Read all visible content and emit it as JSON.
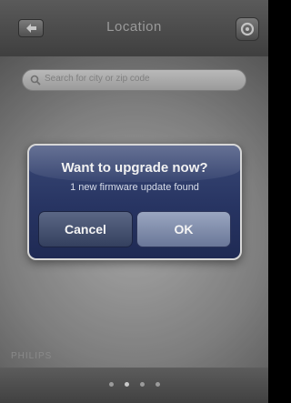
{
  "header": {
    "title": "Location",
    "back_icon": "back-arrow-icon",
    "settings_icon": "gear-icon"
  },
  "search": {
    "placeholder": "Search for city or zip code",
    "icon": "search-icon"
  },
  "alert": {
    "title": "Want to upgrade now?",
    "message": "1 new firmware update found",
    "cancel_label": "Cancel",
    "ok_label": "OK"
  },
  "footer": {
    "brand": "PHILIPS",
    "page_count": 4,
    "active_page": 2
  },
  "colors": {
    "alert_background": "#273462",
    "alert_border": "#d7d7d7"
  }
}
